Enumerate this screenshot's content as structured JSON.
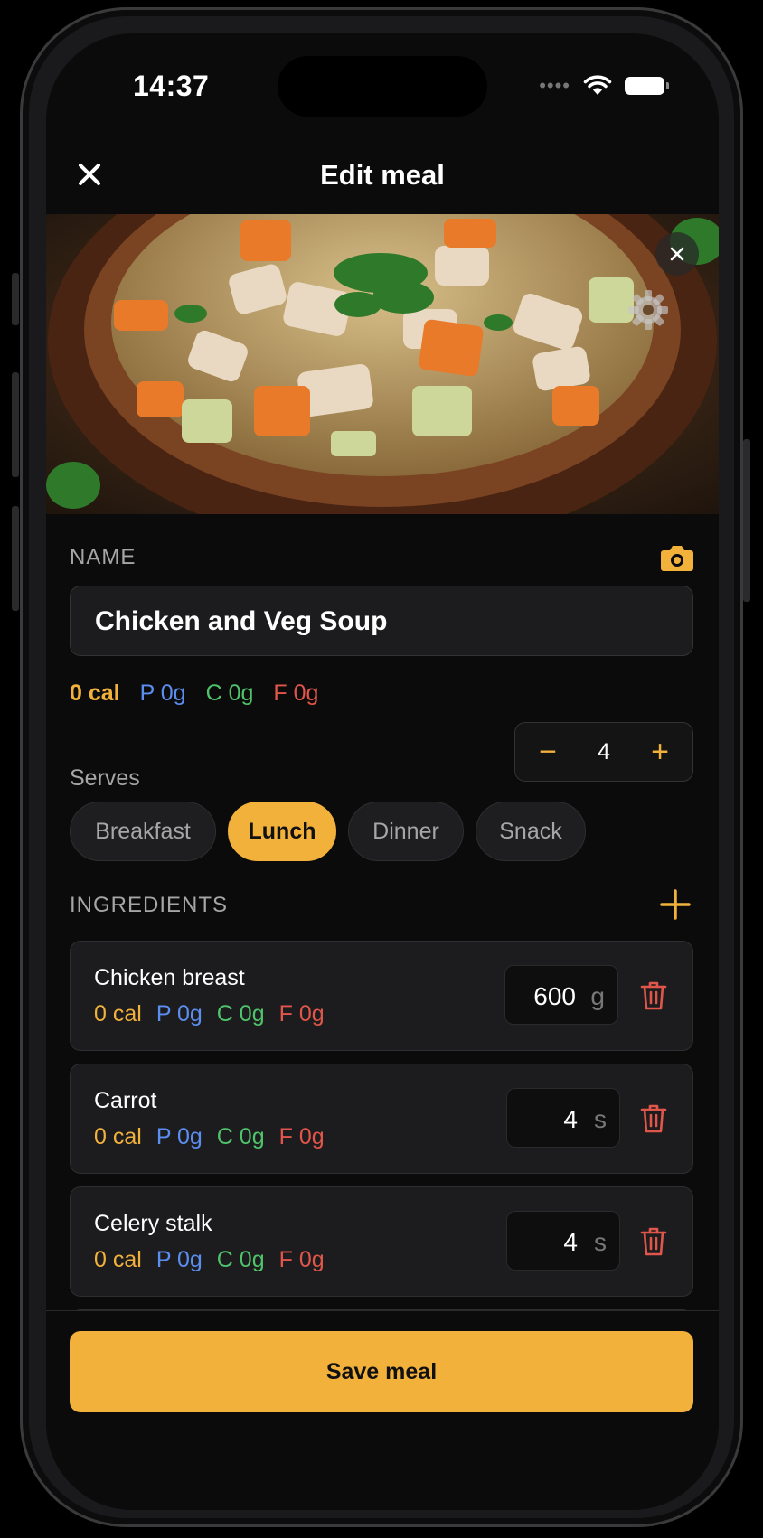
{
  "status": {
    "time": "14:37"
  },
  "nav": {
    "title": "Edit meal"
  },
  "name_section": {
    "label": "NAME",
    "value": "Chicken and Veg Soup"
  },
  "meal_macros": {
    "cal": "0 cal",
    "p": "P 0g",
    "c": "C 0g",
    "f": "F 0g"
  },
  "serves": {
    "label": "Serves",
    "value": "4",
    "minus": "−",
    "plus": "+"
  },
  "meal_types": [
    {
      "label": "Breakfast",
      "active": false
    },
    {
      "label": "Lunch",
      "active": true
    },
    {
      "label": "Dinner",
      "active": false
    },
    {
      "label": "Snack",
      "active": false
    }
  ],
  "ingredients_section": {
    "label": "INGREDIENTS"
  },
  "ingredients": [
    {
      "name": "Chicken breast",
      "cal": "0 cal",
      "p": "P 0g",
      "c": "C 0g",
      "f": "F 0g",
      "qty": "600",
      "unit": "g"
    },
    {
      "name": "Carrot",
      "cal": "0 cal",
      "p": "P 0g",
      "c": "C 0g",
      "f": "F 0g",
      "qty": "4",
      "unit": "s"
    },
    {
      "name": "Celery stalk",
      "cal": "0 cal",
      "p": "P 0g",
      "c": "C 0g",
      "f": "F 0g",
      "qty": "4",
      "unit": "s"
    }
  ],
  "save_button": {
    "label": "Save meal"
  },
  "colors": {
    "accent": "#f2b13a",
    "protein": "#5b8ef0",
    "carbs": "#4fc36a",
    "fat": "#e0564a",
    "background": "#0b0b0b"
  },
  "icons": [
    "close-icon",
    "wifi-icon",
    "battery-icon",
    "gear-icon",
    "camera-icon",
    "plus-icon",
    "minus-icon",
    "trash-icon"
  ]
}
